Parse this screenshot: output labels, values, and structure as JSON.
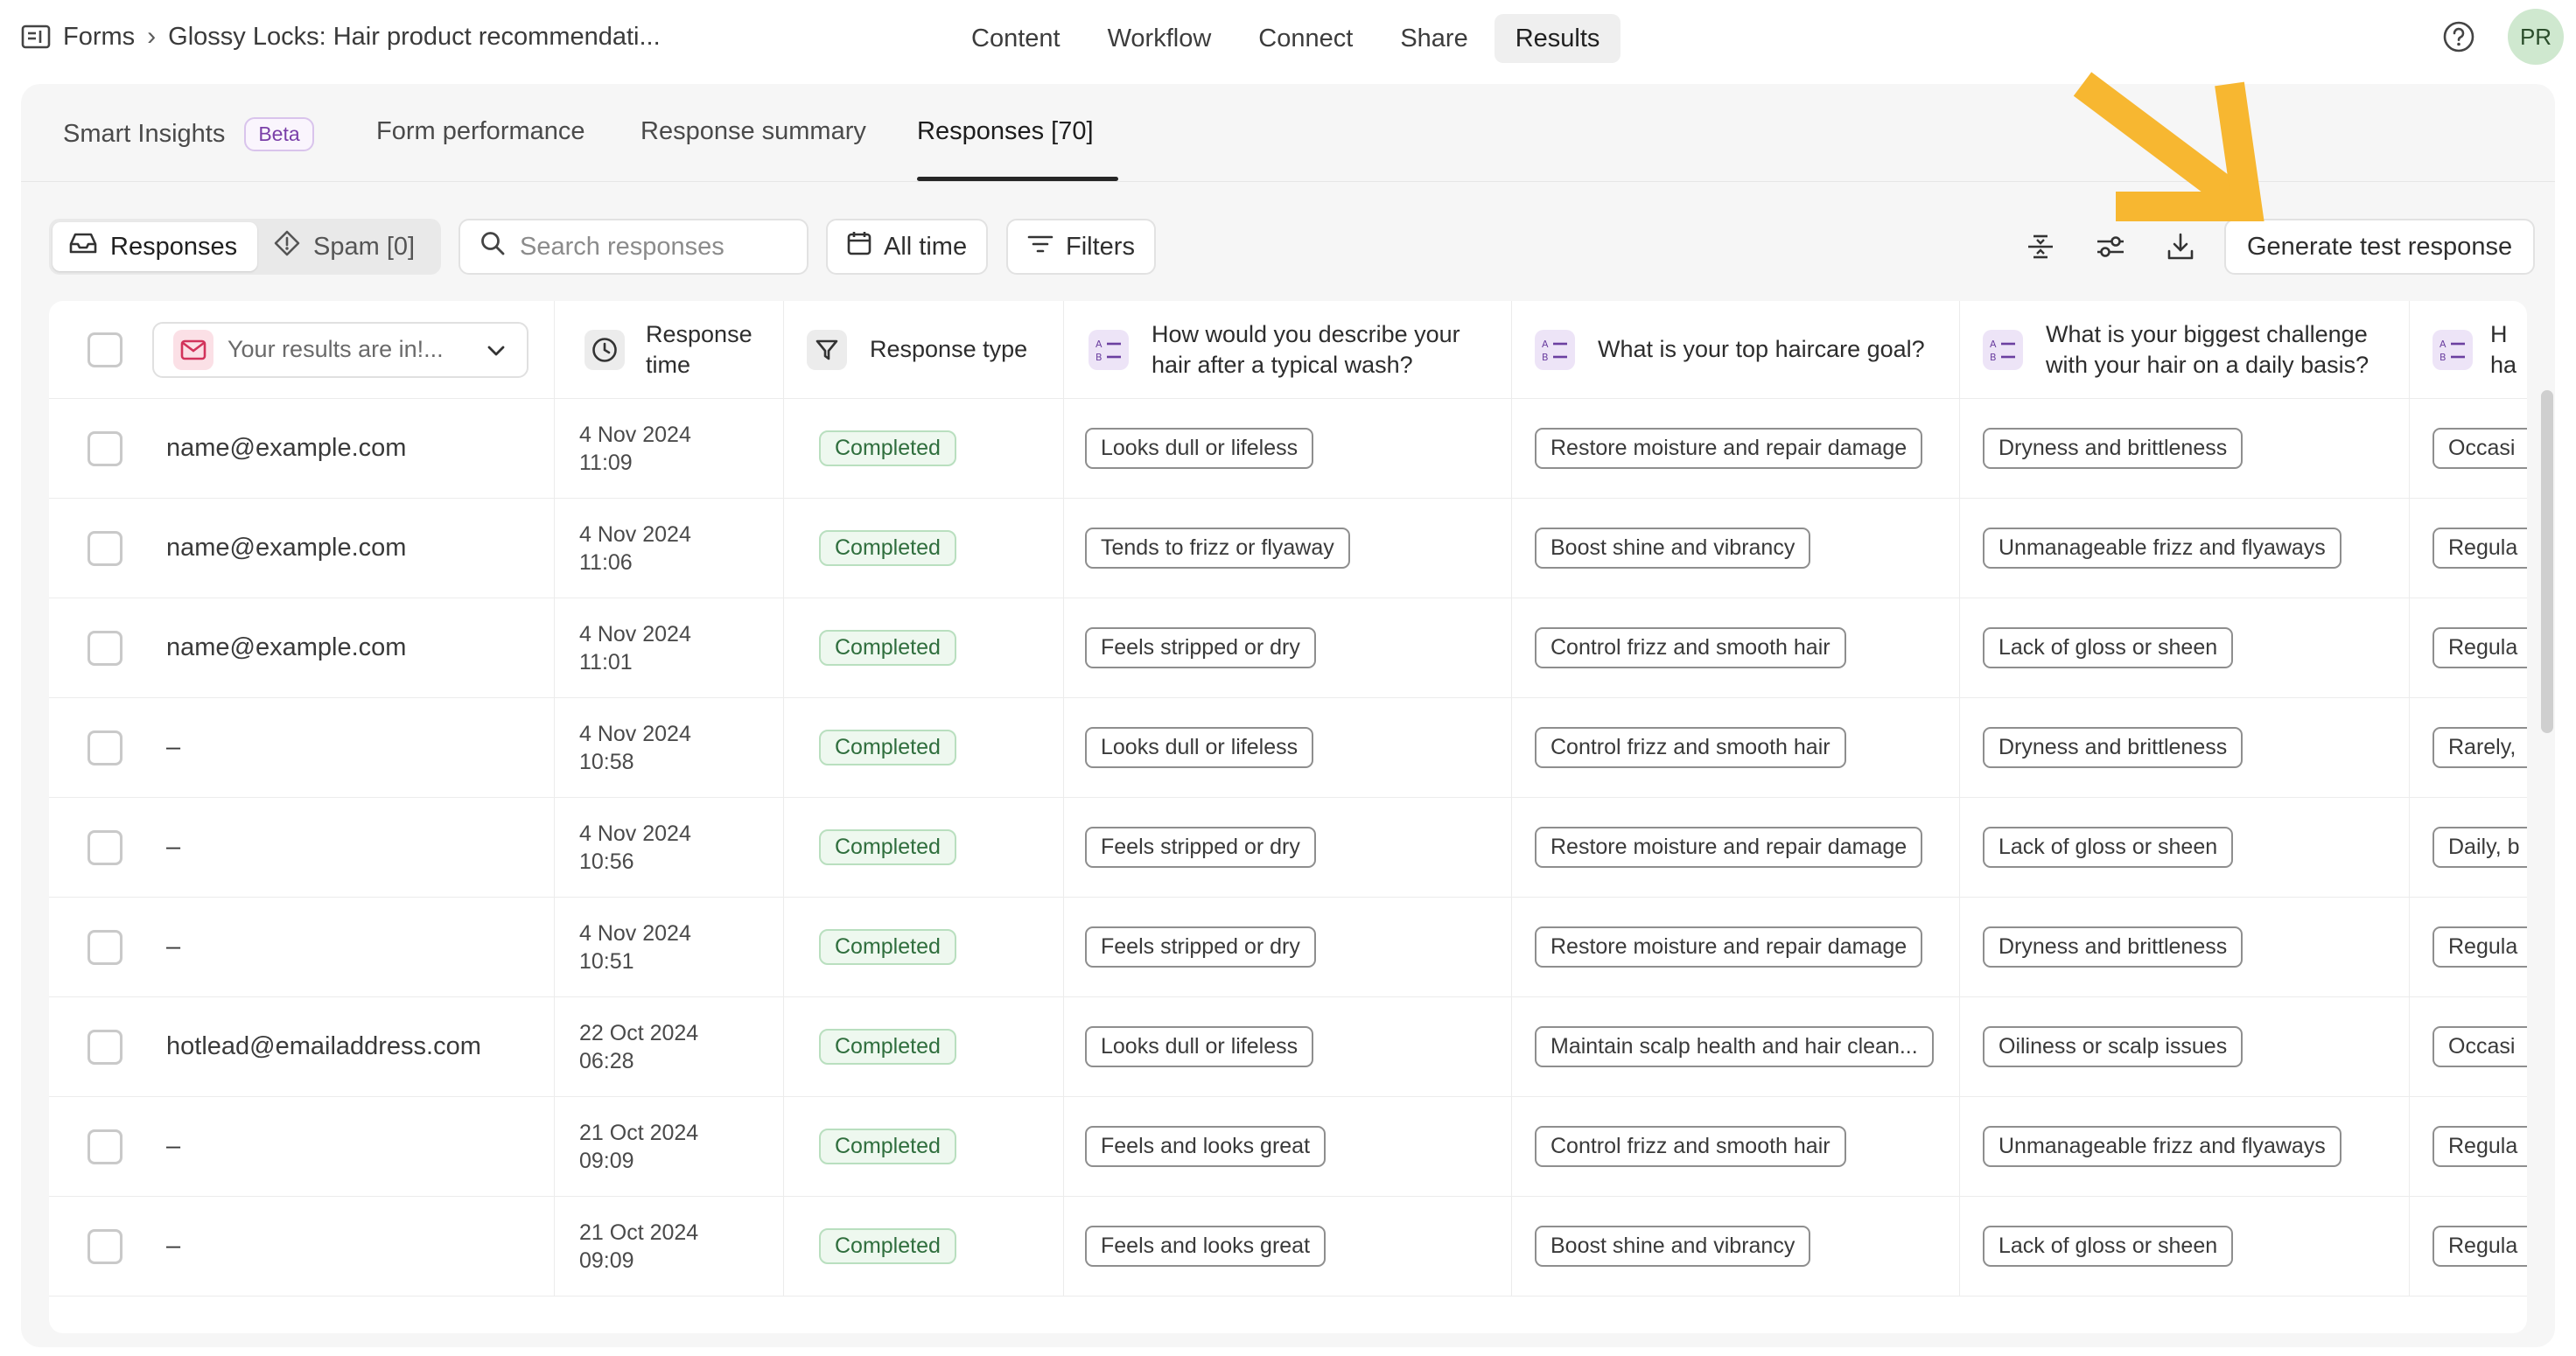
{
  "breadcrumb": {
    "root": "Forms",
    "current": "Glossy Locks: Hair product recommendati..."
  },
  "topnav": [
    "Content",
    "Workflow",
    "Connect",
    "Share",
    "Results"
  ],
  "topnav_active": "Results",
  "avatar": "PR",
  "subtabs": {
    "smart_insights": "Smart Insights",
    "beta": "Beta",
    "form_performance": "Form performance",
    "response_summary": "Response summary",
    "responses": "Responses [70]"
  },
  "toolbar": {
    "responses": "Responses",
    "spam": "Spam [0]",
    "search_placeholder": "Search responses",
    "all_time": "All time",
    "filters": "Filters",
    "generate": "Generate test response"
  },
  "columns": {
    "email_select": "Your results are in!...",
    "response_time": "Response time",
    "response_type": "Response type",
    "q1": "How would you describe your hair after a typical wash?",
    "q2": "What is your top haircare goal?",
    "q3": "What is your biggest challenge with your hair on a daily basis?",
    "q4": "H ha"
  },
  "rows": [
    {
      "email": "name@example.com",
      "date": "4 Nov 2024",
      "time": "11:09",
      "type": "Completed",
      "q1": "Looks dull or lifeless",
      "q2": "Restore moisture and repair damage",
      "q3": "Dryness and brittleness",
      "q4": "Occasi"
    },
    {
      "email": "name@example.com",
      "date": "4 Nov 2024",
      "time": "11:06",
      "type": "Completed",
      "q1": "Tends to frizz or flyaway",
      "q2": "Boost shine and vibrancy",
      "q3": "Unmanageable frizz and flyaways",
      "q4": "Regula"
    },
    {
      "email": "name@example.com",
      "date": "4 Nov 2024",
      "time": "11:01",
      "type": "Completed",
      "q1": "Feels stripped or dry",
      "q2": "Control frizz and smooth hair",
      "q3": "Lack of gloss or sheen",
      "q4": "Regula"
    },
    {
      "email": "–",
      "date": "4 Nov 2024",
      "time": "10:58",
      "type": "Completed",
      "q1": "Looks dull or lifeless",
      "q2": "Control frizz and smooth hair",
      "q3": "Dryness and brittleness",
      "q4": "Rarely,"
    },
    {
      "email": "–",
      "date": "4 Nov 2024",
      "time": "10:56",
      "type": "Completed",
      "q1": "Feels stripped or dry",
      "q2": "Restore moisture and repair damage",
      "q3": "Lack of gloss or sheen",
      "q4": "Daily, b"
    },
    {
      "email": "–",
      "date": "4 Nov 2024",
      "time": "10:51",
      "type": "Completed",
      "q1": "Feels stripped or dry",
      "q2": "Restore moisture and repair damage",
      "q3": "Dryness and brittleness",
      "q4": "Regula"
    },
    {
      "email": "hotlead@emailaddress.com",
      "date": "22 Oct 2024",
      "time": "06:28",
      "type": "Completed",
      "q1": "Looks dull or lifeless",
      "q2": "Maintain scalp health and hair clean...",
      "q3": "Oiliness or scalp issues",
      "q4": "Occasi"
    },
    {
      "email": "–",
      "date": "21 Oct 2024",
      "time": "09:09",
      "type": "Completed",
      "q1": "Feels and looks great",
      "q2": "Control frizz and smooth hair",
      "q3": "Unmanageable frizz and flyaways",
      "q4": "Regula"
    },
    {
      "email": "–",
      "date": "21 Oct 2024",
      "time": "09:09",
      "type": "Completed",
      "q1": "Feels and looks great",
      "q2": "Boost shine and vibrancy",
      "q3": "Lack of gloss or sheen",
      "q4": "Regula"
    }
  ],
  "colors": {
    "accent_arrow": "#f7b731",
    "status_green": "#2f6e3d",
    "question_icon_bg": "#ede4f7"
  }
}
